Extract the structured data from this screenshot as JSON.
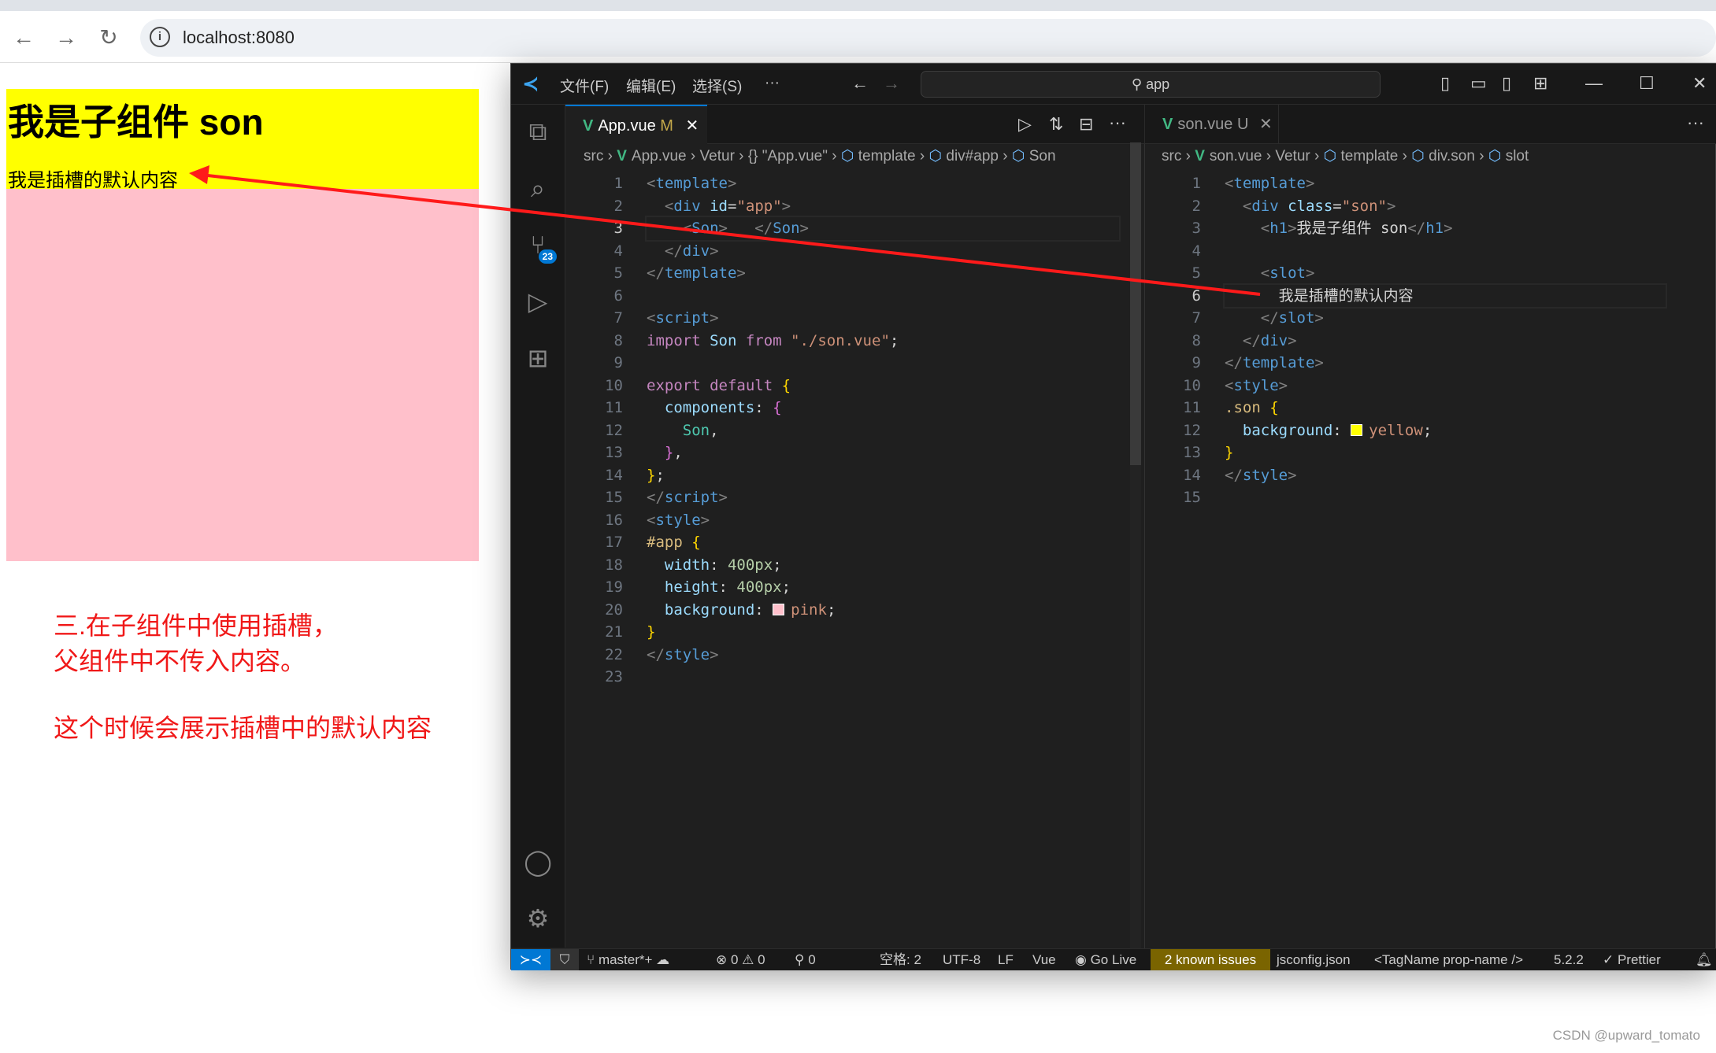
{
  "browser": {
    "url": "localhost:8080",
    "back_icon": "arrow-left",
    "forward_icon": "arrow-right",
    "reload_icon": "reload"
  },
  "page": {
    "son_title": "我是子组件 son",
    "slot_default": "我是插槽的默认内容",
    "notes": [
      "三.在子组件中使用插槽，",
      "父组件中不传入内容。",
      "这个时候会展示插槽中的默认内容"
    ],
    "colors": {
      "son_bg": "#ffff00",
      "app_bg": "#ffc0cb",
      "note": "#f01818"
    }
  },
  "vscode": {
    "menu": [
      "文件(F)",
      "编辑(E)",
      "选择(S)",
      "···"
    ],
    "search": "app",
    "scm_badge": "23",
    "left": {
      "tab": "App.vue",
      "tab_status": "M",
      "breadcrumb": [
        "src",
        "App.vue",
        "Vetur",
        "{} \"App.vue\"",
        "template",
        "div#app",
        "Son"
      ],
      "lines": [
        [
          [
            "<",
            "bk"
          ],
          [
            "template",
            "tg"
          ],
          [
            ">",
            "bk"
          ]
        ],
        [
          [
            "  <",
            "bk"
          ],
          [
            "div",
            "tg"
          ],
          [
            " id",
            "at"
          ],
          [
            "=",
            "tx"
          ],
          [
            "\"app\"",
            "st"
          ],
          [
            ">",
            "bk"
          ]
        ],
        [
          [
            "    <",
            "bk"
          ],
          [
            "Son",
            "tg"
          ],
          [
            ">",
            "bk"
          ],
          [
            "   </",
            "bk"
          ],
          [
            "Son",
            "tg"
          ],
          [
            ">",
            "bk"
          ]
        ],
        [
          [
            "  </",
            "bk"
          ],
          [
            "div",
            "tg"
          ],
          [
            ">",
            "bk"
          ]
        ],
        [
          [
            "</",
            "bk"
          ],
          [
            "template",
            "tg"
          ],
          [
            ">",
            "bk"
          ]
        ],
        [],
        [
          [
            "<",
            "bk"
          ],
          [
            "script",
            "tg"
          ],
          [
            ">",
            "bk"
          ]
        ],
        [
          [
            "import",
            "kw"
          ],
          [
            " Son ",
            "vr"
          ],
          [
            "from",
            "kw"
          ],
          [
            " \"./son.vue\"",
            "st"
          ],
          [
            ";",
            "tx"
          ]
        ],
        [],
        [
          [
            "export default ",
            "kw"
          ],
          [
            "{",
            "by"
          ]
        ],
        [
          [
            "  components",
            "vr"
          ],
          [
            ": ",
            "tx"
          ],
          [
            "{",
            "bp"
          ]
        ],
        [
          [
            "    Son",
            "cl"
          ],
          [
            ",",
            "tx"
          ]
        ],
        [
          [
            "  }",
            "bp"
          ],
          [
            ",",
            "tx"
          ]
        ],
        [
          [
            "}",
            "by"
          ],
          [
            ";",
            "tx"
          ]
        ],
        [
          [
            "</",
            "bk"
          ],
          [
            "script",
            "tg"
          ],
          [
            ">",
            "bk"
          ]
        ],
        [
          [
            "<",
            "bk"
          ],
          [
            "style",
            "tg"
          ],
          [
            ">",
            "bk"
          ]
        ],
        [
          [
            "#app ",
            "sel"
          ],
          [
            "{",
            "by"
          ]
        ],
        [
          [
            "  width",
            "vr"
          ],
          [
            ": ",
            "tx"
          ],
          [
            "400px",
            "nm"
          ],
          [
            ";",
            "tx"
          ]
        ],
        [
          [
            "  height",
            "vr"
          ],
          [
            ": ",
            "tx"
          ],
          [
            "400px",
            "nm"
          ],
          [
            ";",
            "tx"
          ]
        ],
        [
          [
            "  background",
            "vr"
          ],
          [
            ": ",
            "tx"
          ],
          [
            "SW:#ffc0cb",
            "sw"
          ],
          [
            "pink",
            "st"
          ],
          [
            ";",
            "tx"
          ]
        ],
        [
          [
            "}",
            "by"
          ]
        ],
        [
          [
            "</",
            "bk"
          ],
          [
            "style",
            "tg"
          ],
          [
            ">",
            "bk"
          ]
        ],
        []
      ],
      "current_line": 3
    },
    "right": {
      "tab": "son.vue",
      "tab_status": "U",
      "breadcrumb": [
        "src",
        "son.vue",
        "Vetur",
        "template",
        "div.son",
        "slot"
      ],
      "lines": [
        [
          [
            "<",
            "bk"
          ],
          [
            "template",
            "tg"
          ],
          [
            ">",
            "bk"
          ]
        ],
        [
          [
            "  <",
            "bk"
          ],
          [
            "div",
            "tg"
          ],
          [
            " class",
            "at"
          ],
          [
            "=",
            "tx"
          ],
          [
            "\"son\"",
            "st"
          ],
          [
            ">",
            "bk"
          ]
        ],
        [
          [
            "    <",
            "bk"
          ],
          [
            "h1",
            "tg"
          ],
          [
            ">",
            "bk"
          ],
          [
            "我是子组件 son",
            "tx"
          ],
          [
            "</",
            "bk"
          ],
          [
            "h1",
            "tg"
          ],
          [
            ">",
            "bk"
          ]
        ],
        [],
        [
          [
            "    <",
            "bk"
          ],
          [
            "slot",
            "tg"
          ],
          [
            ">",
            "bk"
          ]
        ],
        [
          [
            "      我是插槽的默认内容",
            "tx"
          ]
        ],
        [
          [
            "    </",
            "bk"
          ],
          [
            "slot",
            "tg"
          ],
          [
            ">",
            "bk"
          ]
        ],
        [
          [
            "  </",
            "bk"
          ],
          [
            "div",
            "tg"
          ],
          [
            ">",
            "bk"
          ]
        ],
        [
          [
            "</",
            "bk"
          ],
          [
            "template",
            "tg"
          ],
          [
            ">",
            "bk"
          ]
        ],
        [
          [
            "<",
            "bk"
          ],
          [
            "style",
            "tg"
          ],
          [
            ">",
            "bk"
          ]
        ],
        [
          [
            ".son ",
            "sel"
          ],
          [
            "{",
            "by"
          ]
        ],
        [
          [
            "  background",
            "vr"
          ],
          [
            ": ",
            "tx"
          ],
          [
            "SW:#ffff00",
            "sw"
          ],
          [
            "yellow",
            "st"
          ],
          [
            ";",
            "tx"
          ]
        ],
        [
          [
            "}",
            "by"
          ]
        ],
        [
          [
            "</",
            "bk"
          ],
          [
            "style",
            "tg"
          ],
          [
            ">",
            "bk"
          ]
        ],
        []
      ],
      "current_line": 6
    },
    "status": {
      "branch": "master*+",
      "errors": "0",
      "warnings": "0",
      "ports": "0",
      "spaces": "空格: 2",
      "encoding": "UTF-8",
      "eol": "LF",
      "language": "Vue",
      "golive": "Go Live",
      "issues": "2 known issues",
      "jsconfig": "jsconfig.json",
      "tagname": "<TagName prop-name />",
      "version": "5.2.2",
      "prettier": "Prettier",
      "issues_color": "#7a6400",
      "remote_color": "#0078d4"
    }
  },
  "watermark": "CSDN @upward_tomato"
}
